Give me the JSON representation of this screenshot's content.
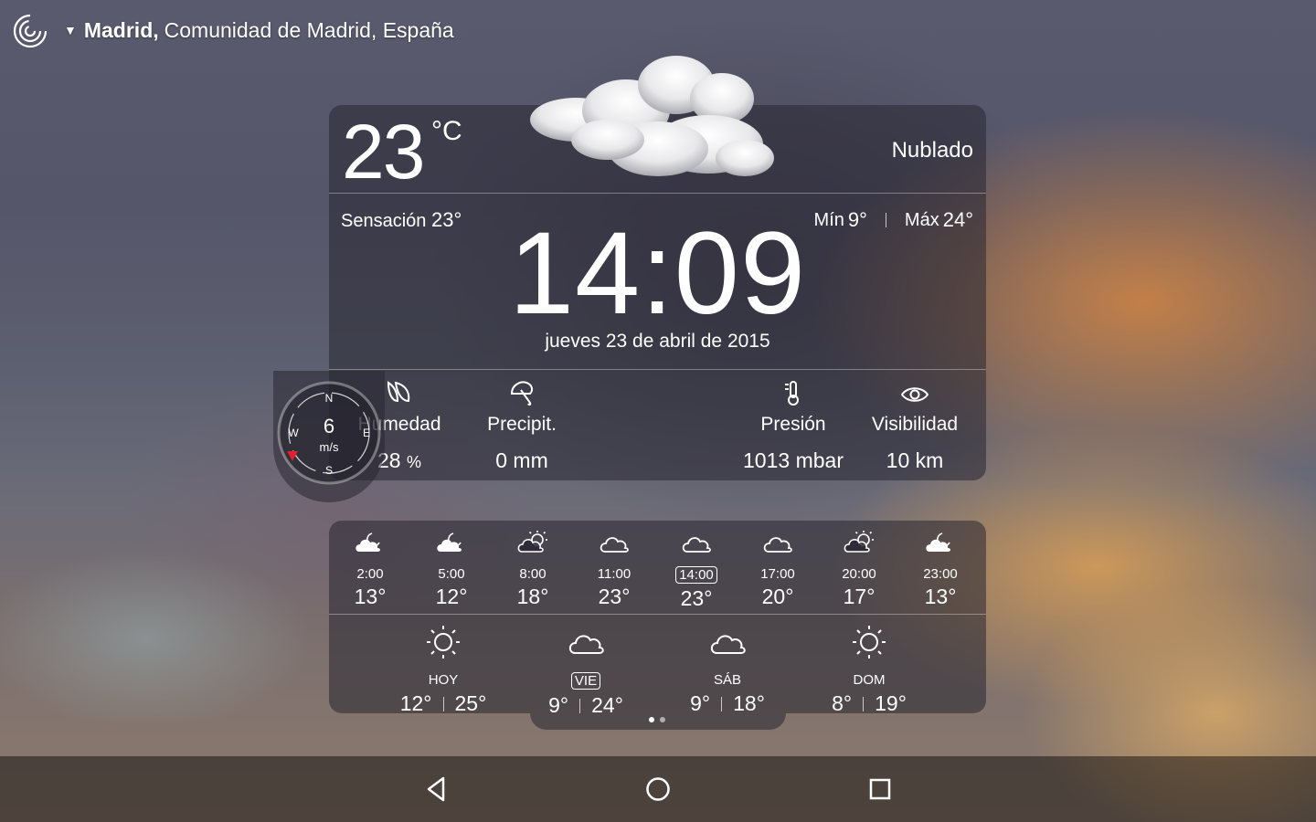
{
  "location": {
    "city": "Madrid,",
    "region": "Comunidad de Madrid, España"
  },
  "current": {
    "temp": "23",
    "unit": "°C",
    "condition": "Nublado",
    "feels_label": "Sensación",
    "feels_value": "23°",
    "min_label": "Mín",
    "min_value": "9°",
    "max_label": "Máx",
    "max_value": "24°",
    "time": "14:09",
    "date": "jueves 23 de abril de 2015"
  },
  "stats": {
    "humidity": {
      "label": "Humedad",
      "value": "28",
      "unit": "%"
    },
    "precip": {
      "label": "Precipit.",
      "value": "0 mm"
    },
    "pressure": {
      "label": "Presión",
      "value": "1013 mbar"
    },
    "visibility": {
      "label": "Visibilidad",
      "value": "10 km"
    }
  },
  "wind": {
    "speed": "6",
    "unit": "m/s",
    "n": "N",
    "e": "E",
    "s": "S",
    "w": "W",
    "direction": "SW"
  },
  "hourly": [
    {
      "time": "2:00",
      "temp": "13°",
      "icon": "cloud-moon-icon"
    },
    {
      "time": "5:00",
      "temp": "12°",
      "icon": "cloud-moon-icon"
    },
    {
      "time": "8:00",
      "temp": "18°",
      "icon": "partly-cloudy-icon"
    },
    {
      "time": "11:00",
      "temp": "23°",
      "icon": "cloud-icon"
    },
    {
      "time": "14:00",
      "temp": "23°",
      "icon": "cloud-icon",
      "selected": true
    },
    {
      "time": "17:00",
      "temp": "20°",
      "icon": "cloud-icon"
    },
    {
      "time": "20:00",
      "temp": "17°",
      "icon": "partly-cloudy-icon"
    },
    {
      "time": "23:00",
      "temp": "13°",
      "icon": "cloud-moon-icon"
    }
  ],
  "daily": [
    {
      "day": "HOY",
      "min": "12°",
      "max": "25°",
      "icon": "sun-icon"
    },
    {
      "day": "VIE",
      "min": "9°",
      "max": "24°",
      "icon": "cloud-icon",
      "selected": true
    },
    {
      "day": "SÁB",
      "min": "9°",
      "max": "18°",
      "icon": "cloud-icon"
    },
    {
      "day": "DOM",
      "min": "8°",
      "max": "19°",
      "icon": "sun-icon"
    }
  ],
  "colors": {
    "panel": "#28263280",
    "wind_arrow": "#e0202a",
    "text": "#ffffff"
  },
  "nav": {
    "back": "back-icon",
    "home": "home-icon",
    "recents": "recents-icon"
  }
}
